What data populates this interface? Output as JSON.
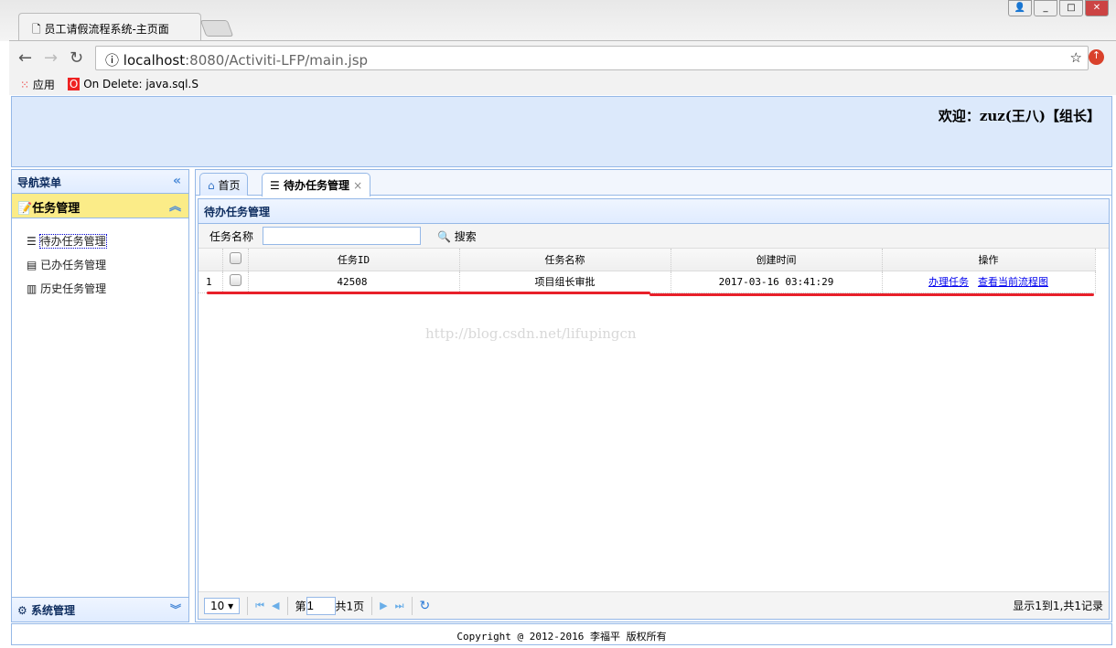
{
  "browser": {
    "tab_title": "员工请假流程系统-主页面",
    "url_host": "localhost",
    "url_rest": ":8080/Activiti-LFP/main.jsp",
    "bookmarks": [
      "应用",
      "On Delete: java.sql.S"
    ]
  },
  "header": {
    "welcome": "欢迎：zuz(王八)【组长】"
  },
  "sidebar": {
    "title": "导航菜单",
    "group": "任务管理",
    "items": [
      {
        "label": "待办任务管理"
      },
      {
        "label": "已办任务管理"
      },
      {
        "label": "历史任务管理"
      }
    ],
    "group2": "系统管理"
  },
  "tabs": [
    {
      "label": "首页"
    },
    {
      "label": "待办任务管理"
    }
  ],
  "panel": {
    "title": "待办任务管理",
    "search_label": "任务名称",
    "search_value": "",
    "search_button": "搜索"
  },
  "table": {
    "columns": [
      "任务ID",
      "任务名称",
      "创建时间",
      "操作"
    ],
    "rows": [
      {
        "num": "1",
        "id": "42508",
        "name": "项目组长审批",
        "created": "2017-03-16 03:41:29",
        "actions": [
          "办理任务",
          "查看当前流程图"
        ]
      }
    ]
  },
  "pager": {
    "page_size": "10",
    "page_prefix": "第",
    "page": "1",
    "page_total": "共1页",
    "summary": "显示1到1,共1记录"
  },
  "footer": "Copyright @ 2012-2016 李福平 版权所有",
  "watermark": "http://blog.csdn.net/lifupingcn"
}
